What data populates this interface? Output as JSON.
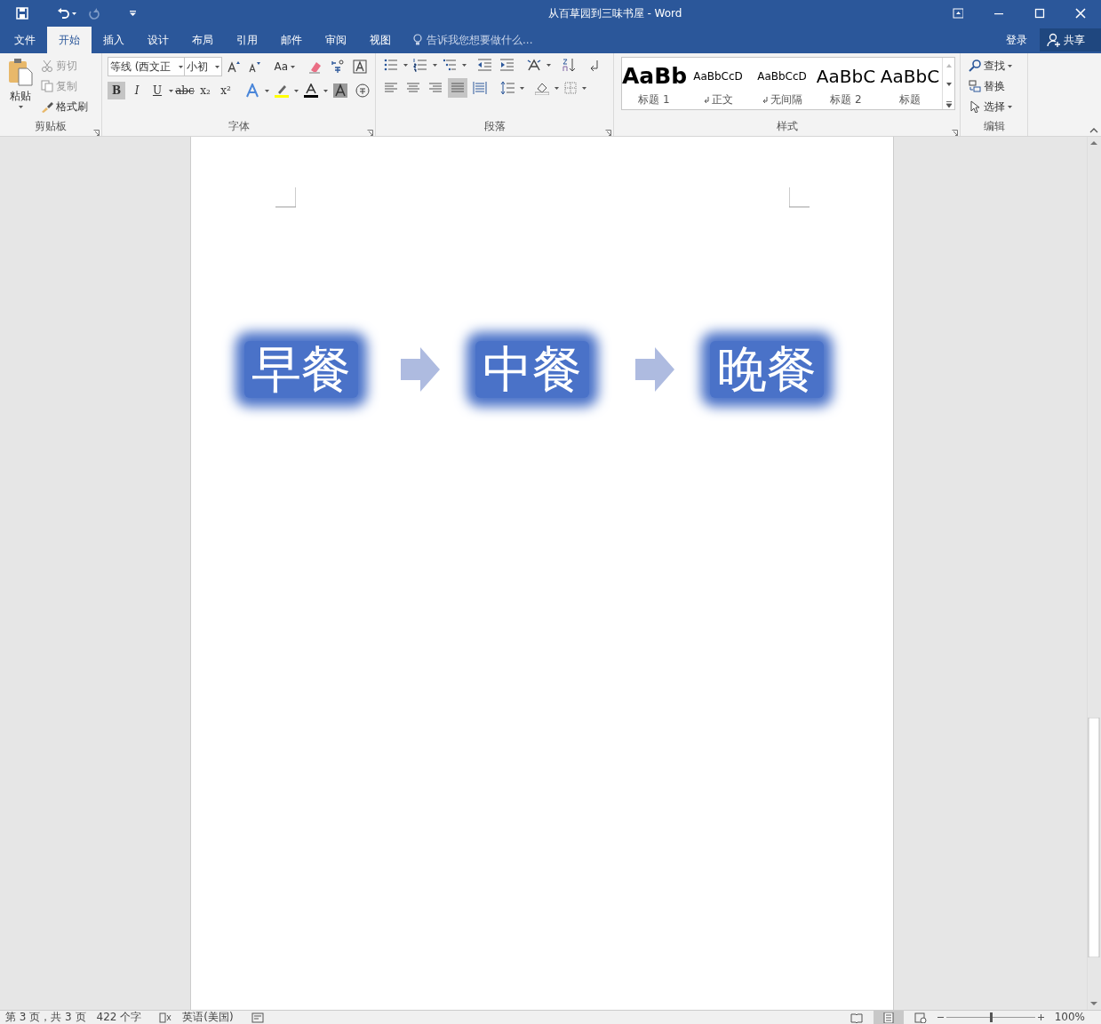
{
  "title_bar": {
    "title": "从百草园到三味书屋 - Word"
  },
  "tabs": [
    {
      "label": "文件",
      "selected": false
    },
    {
      "label": "开始",
      "selected": true
    },
    {
      "label": "插入",
      "selected": false
    },
    {
      "label": "设计",
      "selected": false
    },
    {
      "label": "布局",
      "selected": false
    },
    {
      "label": "引用",
      "selected": false
    },
    {
      "label": "邮件",
      "selected": false
    },
    {
      "label": "审阅",
      "selected": false
    },
    {
      "label": "视图",
      "selected": false
    }
  ],
  "tell_me": {
    "placeholder": "告诉我您想要做什么..."
  },
  "account": {
    "sign_in": "登录",
    "share": "共享"
  },
  "clipboard": {
    "label": "剪贴板",
    "paste": "粘贴",
    "items": [
      {
        "kind": "cut",
        "label": "剪切",
        "disabled": true
      },
      {
        "kind": "copy",
        "label": "复制",
        "disabled": true
      },
      {
        "kind": "painter",
        "label": "格式刷",
        "disabled": false
      }
    ]
  },
  "font": {
    "label": "字体",
    "font_name": "等线 (西文正",
    "font_size": "小初",
    "case_button": "Aa",
    "buttons": [
      {
        "kind": "bold",
        "label": "B",
        "selected": true
      },
      {
        "kind": "italic",
        "label": "I",
        "selected": false
      },
      {
        "kind": "underline",
        "label": "U",
        "selected": false
      },
      {
        "kind": "strike",
        "label": "abc",
        "selected": false
      },
      {
        "kind": "sub",
        "label": "x₂",
        "selected": false
      },
      {
        "kind": "sup",
        "label": "x²",
        "selected": false
      }
    ]
  },
  "paragraph": {
    "label": "段落",
    "alignment": [
      {
        "kind": "left",
        "selected": false
      },
      {
        "kind": "center",
        "selected": false
      },
      {
        "kind": "right",
        "selected": false
      },
      {
        "kind": "justify",
        "selected": true
      },
      {
        "kind": "distributed",
        "selected": false
      }
    ]
  },
  "styles": {
    "label": "样式",
    "items": [
      {
        "preview": "AaBb",
        "name": "标题 1",
        "kind": "heading1",
        "paragraph_mark": false
      },
      {
        "preview": "AaBbCcD",
        "name": "正文",
        "kind": "normal",
        "paragraph_mark": true
      },
      {
        "preview": "AaBbCcD",
        "name": "无间隔",
        "kind": "normal",
        "paragraph_mark": true
      },
      {
        "preview": "AaBbC",
        "name": "标题 2",
        "kind": "heading2",
        "paragraph_mark": false
      },
      {
        "preview": "AaBbC",
        "name": "标题",
        "kind": "heading2",
        "paragraph_mark": false
      }
    ]
  },
  "editing": {
    "label": "编辑",
    "items": [
      {
        "kind": "find",
        "label": "查找"
      },
      {
        "kind": "replace",
        "label": "替换"
      },
      {
        "kind": "select",
        "label": "选择"
      }
    ]
  },
  "diagram": {
    "steps": [
      {
        "label": "早餐"
      },
      {
        "label": "中餐"
      },
      {
        "label": "晚餐"
      }
    ]
  },
  "status_bar": {
    "page": "第 3 页，共 3 页",
    "words": "422 个字",
    "language": "英语(美国)",
    "zoom": "100%",
    "zoom_level": {
      "level": 0.5
    }
  }
}
